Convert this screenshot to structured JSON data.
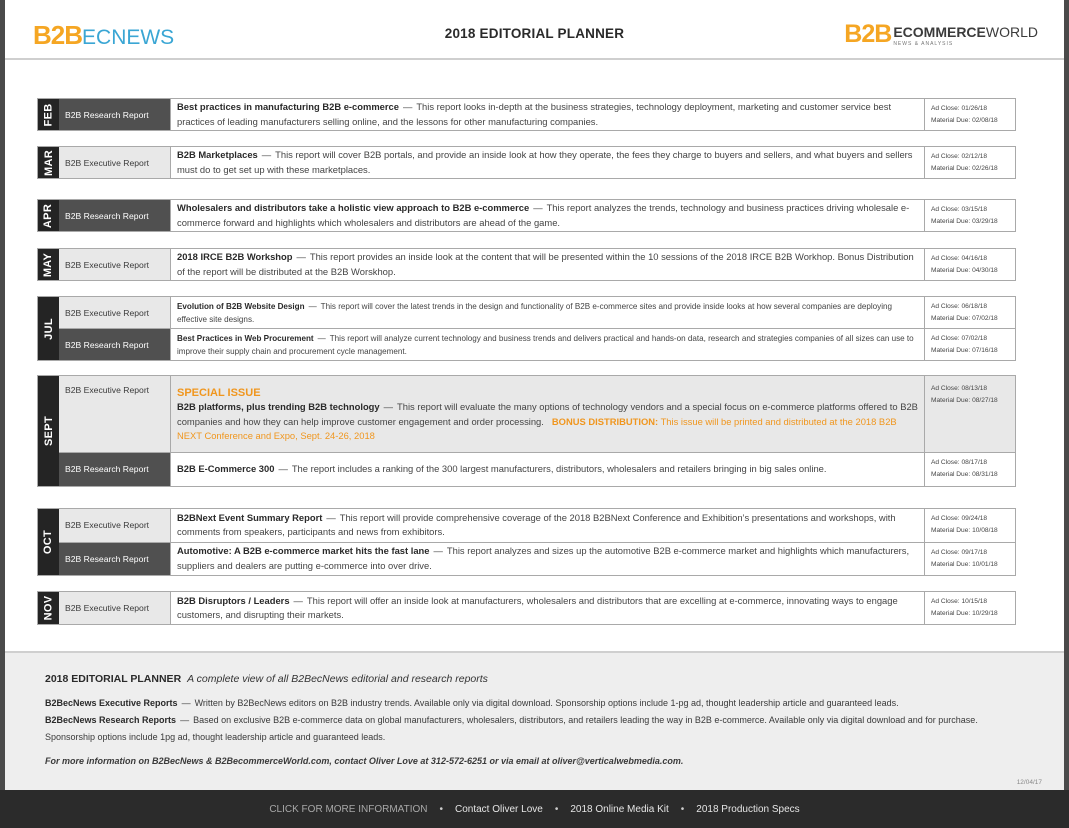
{
  "header": {
    "logo_left_b2b": "B2B",
    "logo_left_ec": "ECNEWS",
    "title": "2018 EDITORIAL PLANNER",
    "logo_right_b2b": "B2B",
    "logo_right_ecommerce": "ECOMMERCE",
    "logo_right_world": "WORLD",
    "logo_right_tagline": "NEWS & ANALYSIS"
  },
  "labels": {
    "ad_close": "Ad Close:",
    "material_due": "Material Due:"
  },
  "months": [
    {
      "month": "FEB",
      "rows": [
        {
          "type": "B2B Research Report",
          "title": "Best practices in manufacturing B2B e-commerce",
          "dash": "—",
          "text": "This report looks in-depth at the business strategies, technology deployment, marketing and customer service best practices of leading manufacturers selling online, and the lessons for other manufacturing companies.",
          "ad_close": "01/26/18",
          "material_due": "02/08/18"
        }
      ]
    },
    {
      "month": "MAR",
      "rows": [
        {
          "type": "B2B Executive Report",
          "title": "B2B Marketplaces",
          "dash": "—",
          "text": "This report will cover B2B portals, and provide an inside look at how they operate, the fees they charge to buyers and sellers, and what buyers and sellers must do to get set up with these marketplaces.",
          "ad_close": "02/12/18",
          "material_due": "02/26/18"
        }
      ]
    },
    {
      "month": "APR",
      "rows": [
        {
          "type": "B2B Research Report",
          "title": "Wholesalers and distributors take a holistic view approach to B2B e-commerce",
          "dash": "—",
          "text": "This report analyzes the trends, technology and business practices driving wholesale e-commerce forward and highlights which wholesalers and distributors are ahead of the game.",
          "ad_close": "03/15/18",
          "material_due": "03/29/18"
        }
      ]
    },
    {
      "month": "MAY",
      "rows": [
        {
          "type": "B2B Executive Report",
          "title": "2018 IRCE B2B Workshop",
          "dash": "—",
          "text": "This report provides an inside look at the content that will be presented within the 10 sessions of the 2018 IRCE B2B Workhop. Bonus Distribution of the report will be distributed at the B2B Worskhop.",
          "ad_close": "04/16/18",
          "material_due": "04/30/18"
        }
      ]
    },
    {
      "month": "JUL",
      "rows": [
        {
          "type": "B2B Executive Report",
          "title": "Evolution of B2B Website Design",
          "dash": "—",
          "text": "This report will cover the latest trends in the design and functionality of B2B e-commerce sites and provide inside looks at how several companies are deploying effective site designs.",
          "ad_close": "06/18/18",
          "material_due": "07/02/18"
        },
        {
          "type": "B2B Research Report",
          "title": "Best Practices in Web Procurement",
          "dash": "—",
          "text": "This report will analyze current technology and business trends and delivers practical and hands-on data, research and strategies companies of all sizes can use to improve their supply chain and procurement cycle management.",
          "ad_close": "07/02/18",
          "material_due": "07/16/18"
        }
      ]
    },
    {
      "month": "SEPT",
      "rows": [
        {
          "type": "B2B Executive Report",
          "special": "SPECIAL ISSUE",
          "title": "B2B platforms, plus trending B2B technology",
          "dash": "—",
          "text": "This report will evaluate the many options of technology vendors and a special focus on e-commerce platforms offered to B2B companies and how they can help improve customer engagement and order processing.",
          "bonus_label": "BONUS DISTRIBUTION:",
          "bonus_text": "This issue will be printed and distributed at the 2018 B2B NEXT Conference and Expo, Sept. 24-26, 2018",
          "ad_close": "08/13/18",
          "material_due": "08/27/18"
        },
        {
          "type": "B2B Research Report",
          "title": "B2B E-Commerce 300",
          "dash": "—",
          "text": "The report includes a ranking of the 300 largest manufacturers, distributors, wholesalers and retailers bringing in big sales online.",
          "ad_close": "08/17/18",
          "material_due": "08/31/18"
        }
      ]
    },
    {
      "month": "OCT",
      "rows": [
        {
          "type": "B2B Executive Report",
          "title": "B2BNext Event Summary Report",
          "dash": "—",
          "text": "This report will provide comprehensive coverage of the 2018 B2BNext Conference and Exhibition’s presentations and workshops, with comments from speakers, participants and news from exhibitors.",
          "ad_close": "09/24/18",
          "material_due": "10/08/18"
        },
        {
          "type": "B2B Research Report",
          "title": "Automotive: A B2B e-commerce market hits the fast lane",
          "dash": "—",
          "text": "This report analyzes and sizes up the automotive B2B e-commerce market and highlights which manufacturers, suppliers and dealers are putting e-commerce into over drive.",
          "ad_close": "09/17/18",
          "material_due": "10/01/18"
        }
      ]
    },
    {
      "month": "NOV",
      "rows": [
        {
          "type": "B2B Executive Report",
          "title": "B2B Disruptors / Leaders",
          "dash": "—",
          "text": "This report will offer an inside look at manufacturers, wholesalers and distributors that are excelling at e-commerce, innovating ways to engage customers, and disrupting their markets.",
          "ad_close": "10/15/18",
          "material_due": "10/29/18"
        }
      ]
    }
  ],
  "footer_info": {
    "title": "2018 EDITORIAL PLANNER",
    "subtitle": "A complete view of all B2BecNews editorial and research reports",
    "exec_label": "B2BecNews  Executive Reports",
    "exec_text": "Written by B2BecNews editors on B2B industry trends.  Available only via digital download. Sponsorship options include 1-pg ad,  thought leadership article and guaranteed leads.",
    "research_label": "B2BecNews Research Reports",
    "research_text": "Based on exclusive B2B e-commerce data on  global manufacturers, wholesalers, distributors, and retailers leading the way in B2B e-commerce. Available only via digital download and for purchase.  Sponsorship options include 1pg ad,  thought leadership article and guaranteed leads.",
    "contact": "For more information on B2BecNews & B2BecommerceWorld.com, contact  Oliver Love  at   312-572-6251 or via email at oliver@verticalwebmedia.com.",
    "date_stamp": "12/04/17"
  },
  "bottom_bar": {
    "click": "CLICK FOR MORE INFORMATION",
    "dot": "•",
    "links": [
      "Contact Oliver Love",
      "2018 Online Media Kit",
      "2018 Production Specs"
    ]
  }
}
